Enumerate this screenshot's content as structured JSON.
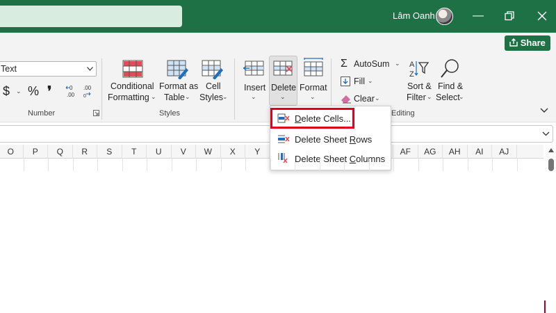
{
  "titlebar": {
    "user_name": "Lâm Oanh",
    "bg_color": "#1e7145"
  },
  "share": {
    "label": "Share",
    "icon": "share-icon"
  },
  "ribbon": {
    "number_group": {
      "format_value": "Text",
      "symbols": {
        "currency": "$",
        "percent": "%",
        "comma": "❜"
      },
      "label": "Number"
    },
    "styles_group": {
      "conditional": [
        "Conditional",
        "Formatting"
      ],
      "format_table": [
        "Format as",
        "Table"
      ],
      "cell_styles": [
        "Cell",
        "Styles"
      ],
      "label": "Styles"
    },
    "cells_group": {
      "insert": "Insert",
      "delete": "Delete",
      "format": "Format"
    },
    "editing_group": {
      "autosum": "AutoSum",
      "fill": "Fill",
      "clear": "Clear",
      "sort_filter": [
        "Sort &",
        "Filter"
      ],
      "find_select": [
        "Find &",
        "Select"
      ],
      "label": "Editing"
    }
  },
  "columns": [
    "O",
    "P",
    "Q",
    "R",
    "S",
    "T",
    "U",
    "V",
    "W",
    "X",
    "Y",
    "",
    "",
    "",
    "",
    "AE",
    "AF",
    "AG",
    "AH",
    "AI",
    "AJ"
  ],
  "delete_menu": {
    "items": [
      {
        "pre": "",
        "ul": "D",
        "post": "elete Cells...",
        "icon": "delete-cells-icon"
      },
      {
        "pre": "Delete Sheet ",
        "ul": "R",
        "post": "ows",
        "icon": "delete-rows-icon"
      },
      {
        "pre": "Delete Sheet ",
        "ul": "C",
        "post": "olumns",
        "icon": "delete-columns-icon"
      }
    ],
    "highlight_color": "#e3001b"
  }
}
